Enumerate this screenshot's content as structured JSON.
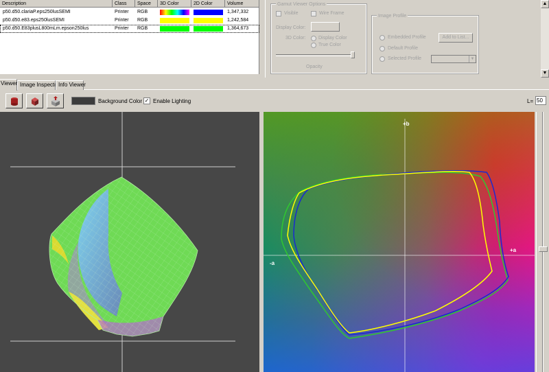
{
  "profile_table": {
    "columns": [
      "Description",
      "Class",
      "Space",
      "3D Color",
      "2D Color",
      "Volume"
    ],
    "rows": [
      {
        "description": "p50.d50.clariaP.eps250lusSEMI",
        "class": "Printer",
        "space": "RGB",
        "color3d": "rainbow",
        "color2d": "#0000ff",
        "volume": "1,347,332",
        "selected": false
      },
      {
        "description": "p50.d50.e83.eps250lusSEMI",
        "class": "Printer",
        "space": "RGB",
        "color3d": "#ffff00",
        "color2d": "#ffff00",
        "volume": "1,242,584",
        "selected": false
      },
      {
        "description": "p50.d50.E83plusL800mLm.epson250lus",
        "class": "Printer",
        "space": "RGB",
        "color3d": "#00ff00",
        "color2d": "#00ff00",
        "volume": "1,364,673",
        "selected": true
      }
    ]
  },
  "gamut_options": {
    "title": "Gamut Viewer Options",
    "visible_label": "Visible",
    "wireframe_label": "Wire Frame",
    "display_color_label": "Display Color:",
    "color_3d_label": "3D Color:",
    "display_color_option": "Display Color",
    "true_color_option": "True Color",
    "opacity_label": "Opacity"
  },
  "image_profile": {
    "title": "Image Profile",
    "embedded_label": "Embedded Profile",
    "default_label": "Default Profile",
    "selected_label": "Selected Profile",
    "add_button": "Add to List..."
  },
  "tabs": [
    {
      "label": "Viewer",
      "active": true
    },
    {
      "label": "Image Inspector",
      "active": false
    },
    {
      "label": "Info Viewer",
      "active": false
    }
  ],
  "toolbar": {
    "background_color_label": "Background Color",
    "background_color": "#3c3c3c",
    "enable_lighting_label": "Enable Lighting",
    "enable_lighting_checked": true,
    "l_label": "L=",
    "l_value": "50"
  },
  "ab_plot": {
    "plus_b_label": "+b",
    "plus_a_label": "+a",
    "minus_a_label": "-a",
    "gamut_colors": {
      "blue": "#1a2ad0",
      "yellow": "#ffff00",
      "green": "#30c830"
    }
  },
  "colors": {
    "window_bg": "#d4d0c8",
    "viewer_bg": "#474747"
  }
}
